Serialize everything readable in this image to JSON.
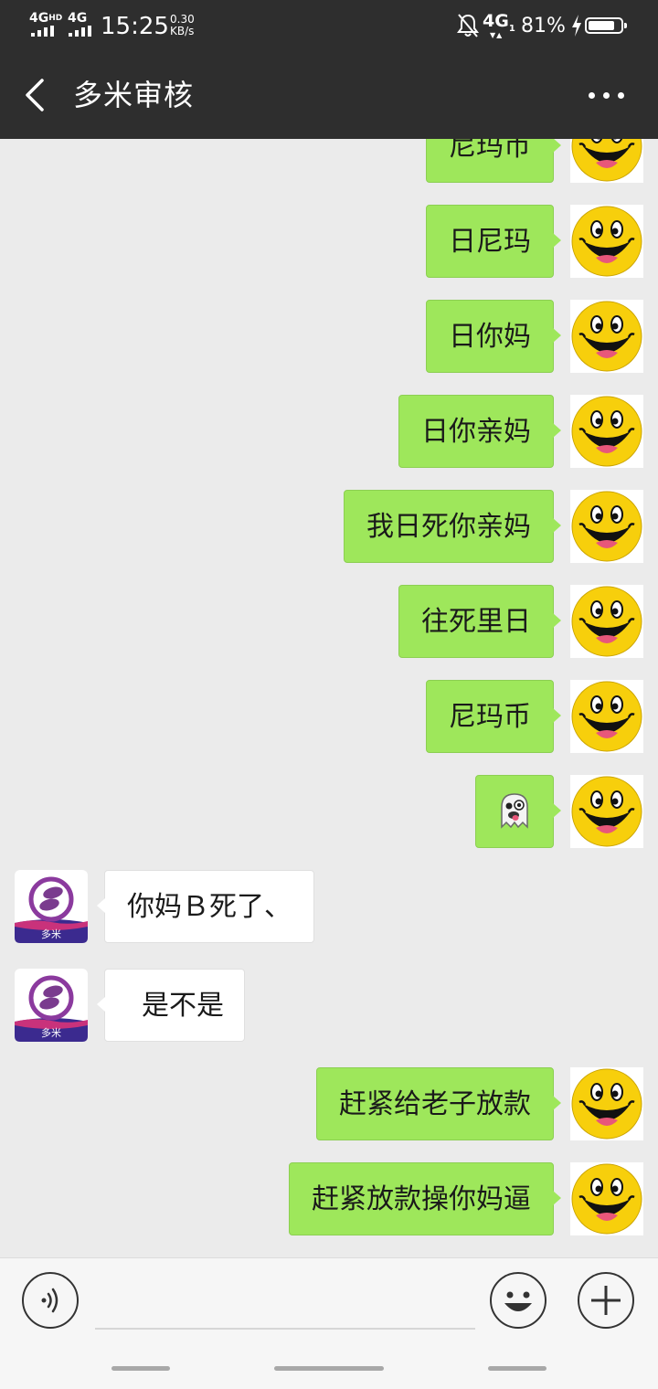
{
  "status_bar": {
    "sim1": "4G",
    "sim1_sup": "HD",
    "sim2": "4G",
    "time": "15:25",
    "speed_value": "0.30",
    "speed_unit": "KB/s",
    "network": "4G",
    "network_sub": "1",
    "battery_percent": "81%",
    "battery_level": 0.81
  },
  "header": {
    "title": "多米审核",
    "back_icon": "chevron-left-icon",
    "more_icon": "more-dots-icon"
  },
  "colors": {
    "header_bg": "#2e2e2e",
    "chat_bg": "#ebebeb",
    "my_bubble": "#9ee75b",
    "their_bubble": "#ffffff"
  },
  "messages": [
    {
      "sender": "me",
      "text": "尼玛币"
    },
    {
      "sender": "me",
      "text": "日尼玛"
    },
    {
      "sender": "me",
      "text": "日你妈"
    },
    {
      "sender": "me",
      "text": "日你亲妈"
    },
    {
      "sender": "me",
      "text": "我日死你亲妈"
    },
    {
      "sender": "me",
      "text": "往死里日"
    },
    {
      "sender": "me",
      "text": "尼玛币"
    },
    {
      "sender": "me",
      "text": "",
      "emoji": "ghost-emoji"
    },
    {
      "sender": "other",
      "text": "你妈Ｂ死了、"
    },
    {
      "sender": "other",
      "text": "是不是"
    },
    {
      "sender": "me",
      "text": "赶紧给老子放款"
    },
    {
      "sender": "me",
      "text": "赶紧放款操你妈逼"
    }
  ],
  "avatars": {
    "me": "smiley-face-avatar",
    "other_logo_text": "多米"
  },
  "input_bar": {
    "voice_icon": "voice-icon",
    "emoji_icon": "emoji-icon",
    "plus_icon": "plus-icon",
    "text_value": ""
  }
}
